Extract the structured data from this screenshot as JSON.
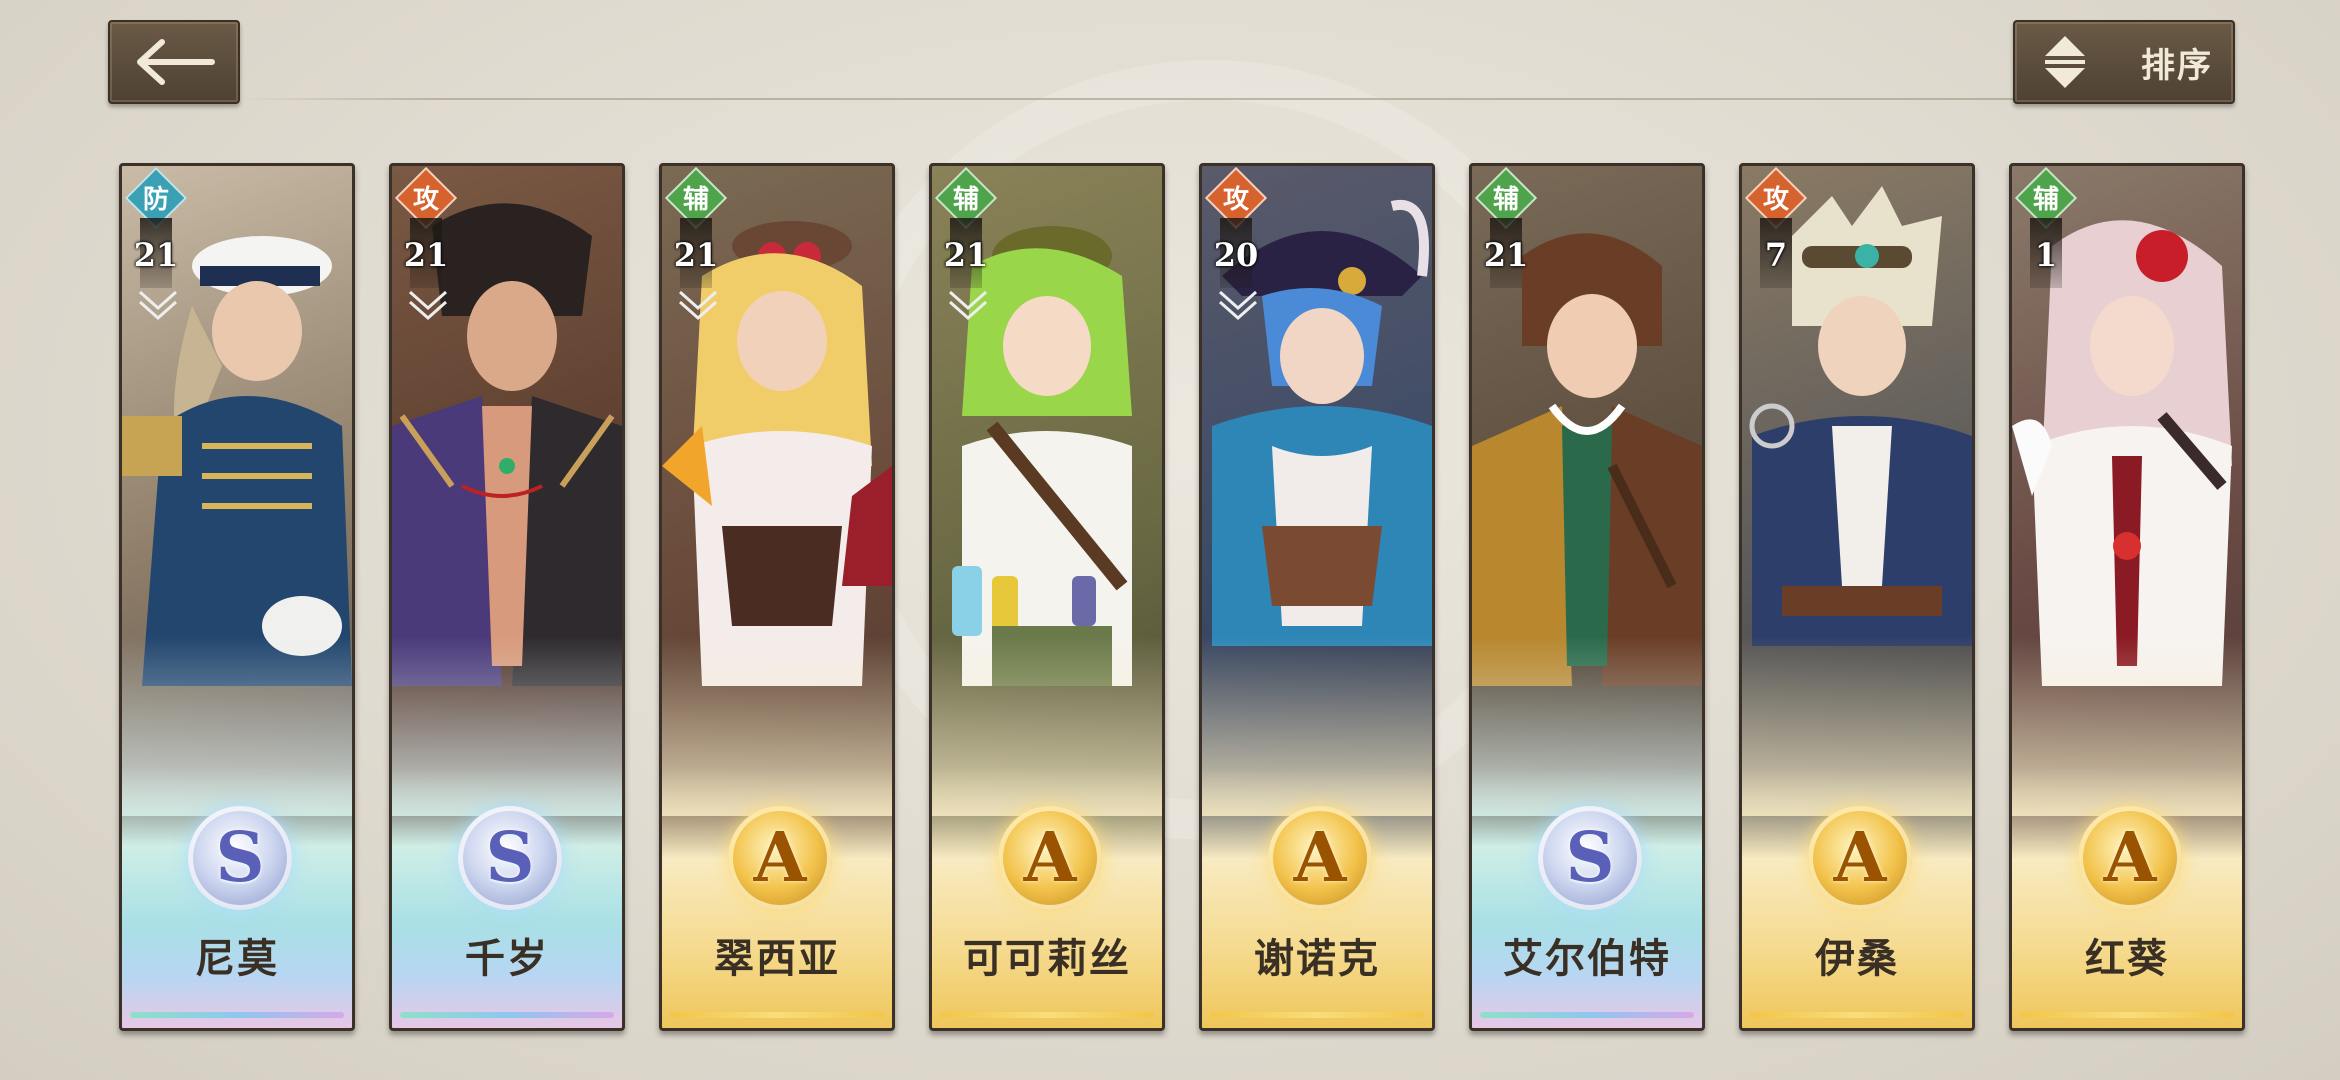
{
  "header": {
    "back_icon": "arrow-left-icon",
    "sort_icon": "sort-up-down-icon",
    "sort_label": "排序"
  },
  "colors": {
    "role_def": "#3aa1b4",
    "role_atk": "#d6622e",
    "role_sup": "#4fa34a",
    "button_bg": "#5a4a3a"
  },
  "cards": [
    {
      "role": "防",
      "level": "21",
      "rank": "S",
      "name": "尼莫"
    },
    {
      "role": "攻",
      "level": "21",
      "rank": "S",
      "name": "千岁"
    },
    {
      "role": "辅",
      "level": "21",
      "rank": "A",
      "name": "翠西亚"
    },
    {
      "role": "辅",
      "level": "21",
      "rank": "A",
      "name": "可可莉丝"
    },
    {
      "role": "攻",
      "level": "20",
      "rank": "A",
      "name": "谢诺克"
    },
    {
      "role": "辅",
      "level": "21",
      "rank": "S",
      "name": "艾尔伯特"
    },
    {
      "role": "攻",
      "level": "7",
      "rank": "A",
      "name": "伊桑"
    },
    {
      "role": "辅",
      "level": "1",
      "rank": "A",
      "name": "红葵"
    }
  ]
}
